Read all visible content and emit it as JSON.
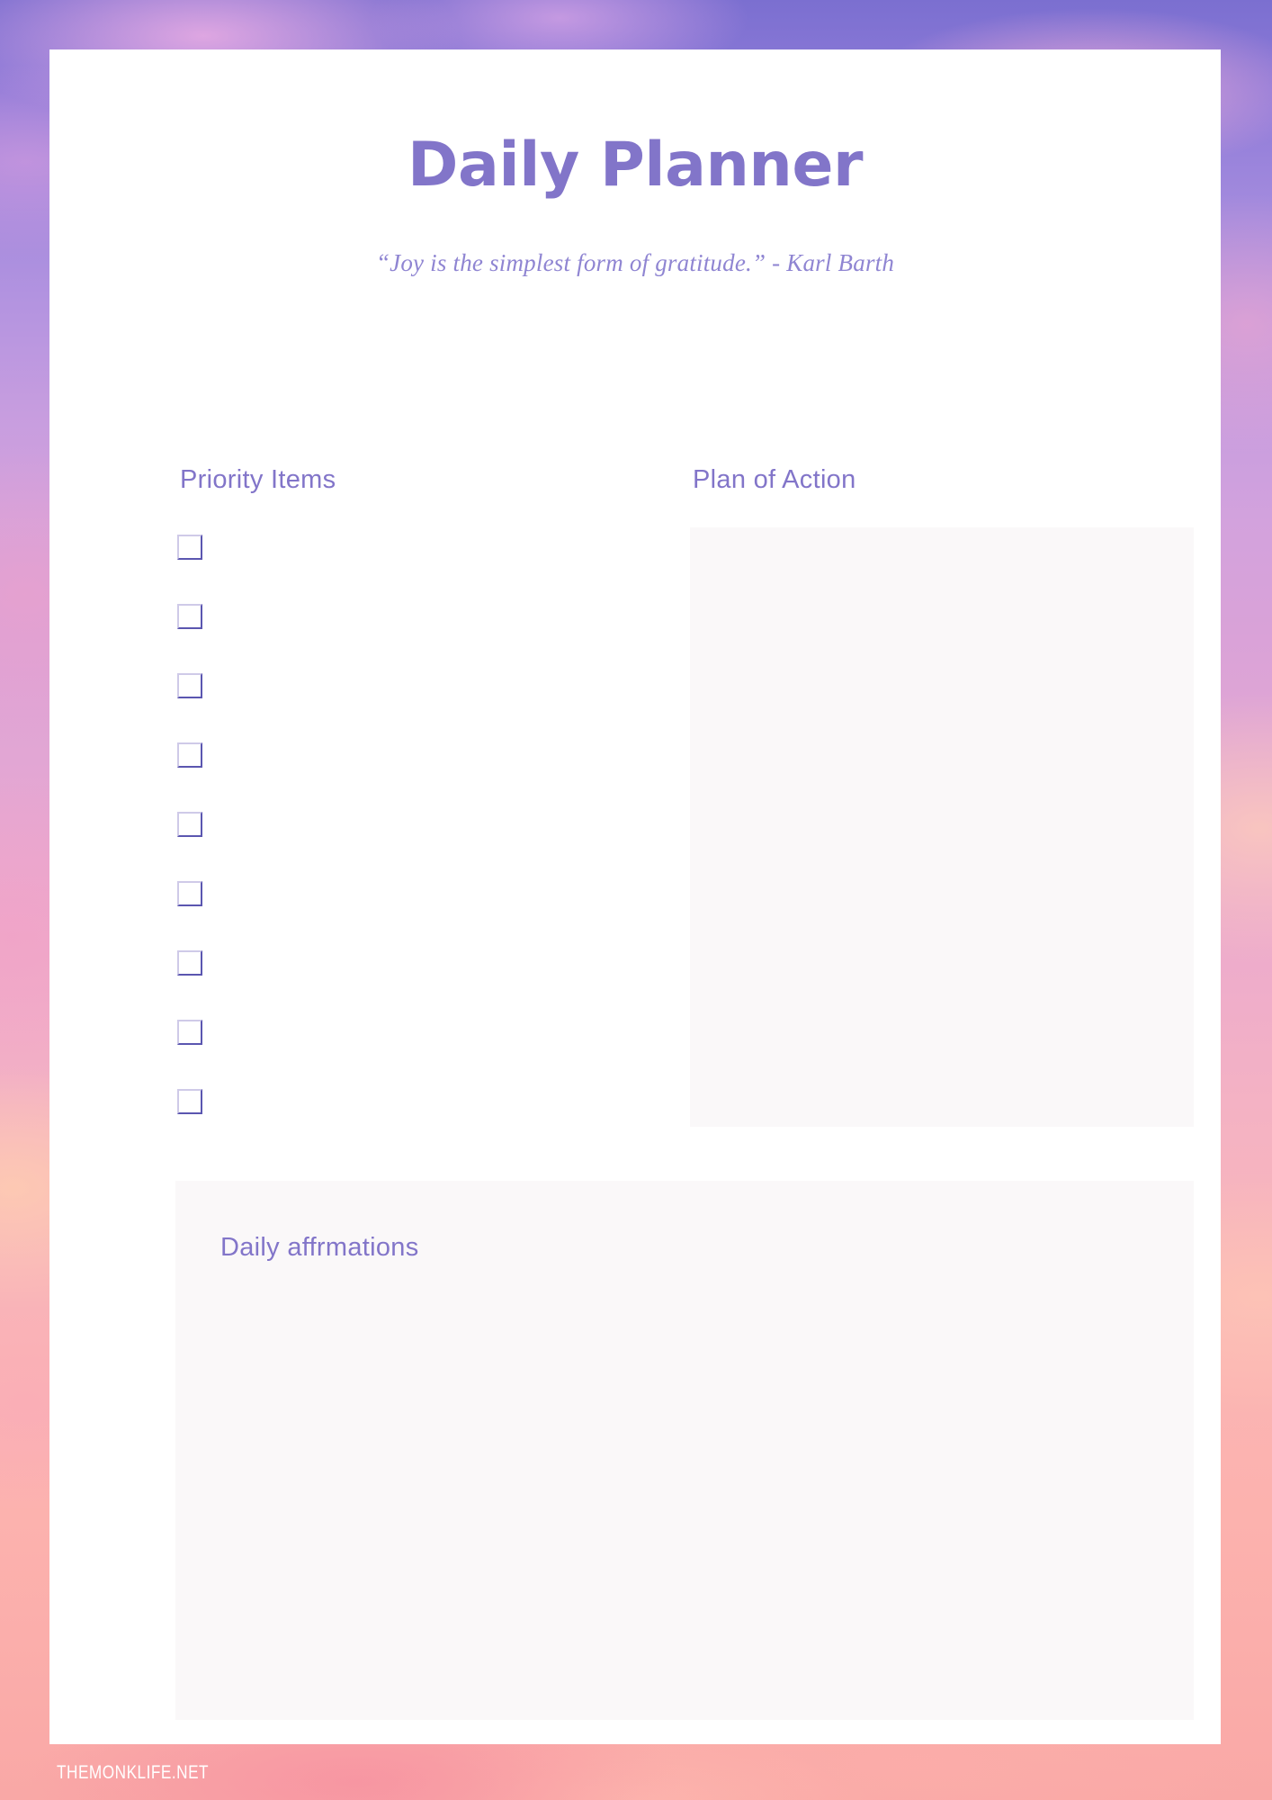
{
  "page": {
    "title": "Daily Planner",
    "quote": "“Joy is the simplest form of gratitude.” - Karl Barth",
    "watermark": "THEMONKLIFE.NET"
  },
  "colors": {
    "accent_purple": "#8275c9",
    "quote_purple": "#8f85d2",
    "checkbox_border_dark": "#5b56b0",
    "checkbox_border_light": "#cfcae8",
    "panel_fill": "#faf8f9",
    "card_background": "#ffffff",
    "bg_top": "#7b6fd0",
    "bg_bottom": "#f9a8a6"
  },
  "sections": {
    "priority": {
      "heading": "Priority Items",
      "items": [
        {
          "checked": false,
          "text": ""
        },
        {
          "checked": false,
          "text": ""
        },
        {
          "checked": false,
          "text": ""
        },
        {
          "checked": false,
          "text": ""
        },
        {
          "checked": false,
          "text": ""
        },
        {
          "checked": false,
          "text": ""
        },
        {
          "checked": false,
          "text": ""
        },
        {
          "checked": false,
          "text": ""
        },
        {
          "checked": false,
          "text": ""
        }
      ]
    },
    "plan_of_action": {
      "heading": "Plan of Action",
      "content": ""
    },
    "affirmations": {
      "heading": "Daily affrmations",
      "content": ""
    }
  }
}
